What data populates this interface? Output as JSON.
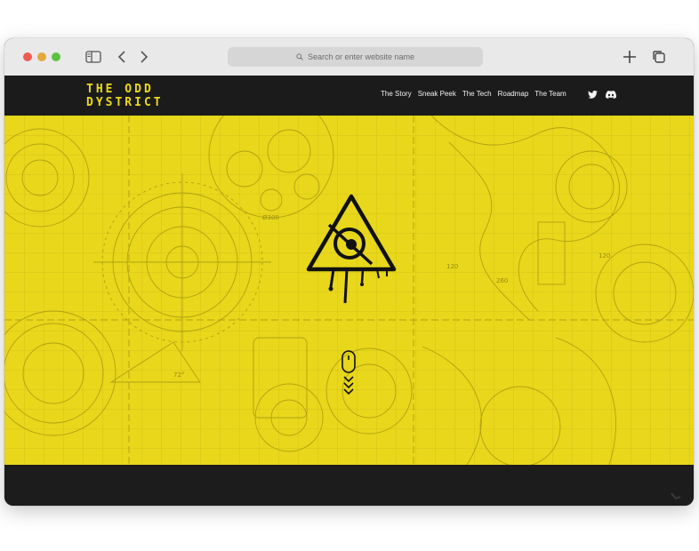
{
  "browser": {
    "address_placeholder": "Search or enter website name"
  },
  "site": {
    "logo_line1": "THE ODD",
    "logo_line2": "DYSTRICT",
    "nav": [
      {
        "label": "The Story"
      },
      {
        "label": "Sneak Peek"
      },
      {
        "label": "The Tech"
      },
      {
        "label": "Roadmap"
      },
      {
        "label": "The Team"
      }
    ],
    "social": [
      "twitter-icon",
      "discord-icon"
    ],
    "blueprint_labels": {
      "a": "Ø300",
      "b": "120",
      "c": "260",
      "d": "72°",
      "e": "120"
    }
  },
  "colors": {
    "brand_yellow": "#e8d71b",
    "header_black": "#1b1b1b",
    "logo_yellow": "#ecd91d"
  }
}
